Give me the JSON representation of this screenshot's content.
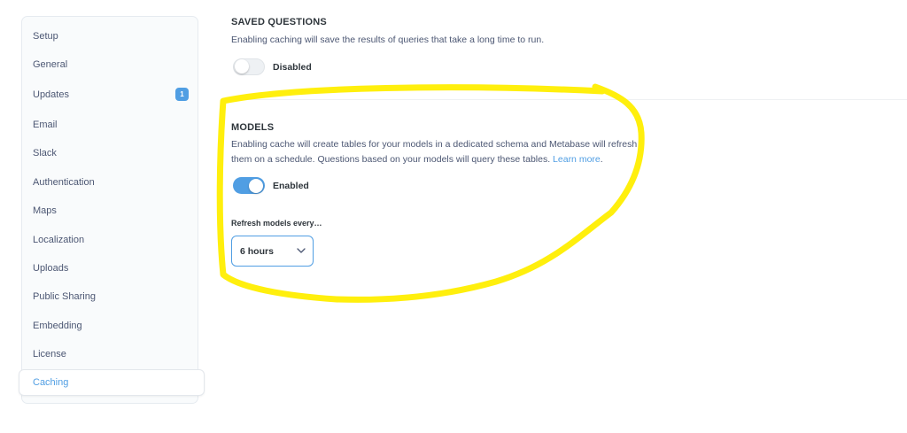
{
  "sidebar": {
    "items": [
      {
        "label": "Setup"
      },
      {
        "label": "General"
      },
      {
        "label": "Updates",
        "badge": "1"
      },
      {
        "label": "Email"
      },
      {
        "label": "Slack"
      },
      {
        "label": "Authentication"
      },
      {
        "label": "Maps"
      },
      {
        "label": "Localization"
      },
      {
        "label": "Uploads"
      },
      {
        "label": "Public Sharing"
      },
      {
        "label": "Embedding"
      },
      {
        "label": "License"
      },
      {
        "label": "Caching",
        "active": true
      }
    ]
  },
  "saved_questions": {
    "title": "SAVED QUESTIONS",
    "description": "Enabling caching will save the results of queries that take a long time to run.",
    "toggle_label": "Disabled",
    "enabled": false
  },
  "models": {
    "title": "MODELS",
    "description_line1": "Enabling cache will create tables for your models in a dedicated schema and Metabase will refresh",
    "description_line2": "them on a schedule. Questions based on your models will query these tables.",
    "learn_more": "Learn more",
    "description_end": ".",
    "toggle_label": "Enabled",
    "enabled": true,
    "refresh_label": "Refresh models every…",
    "refresh_value": "6 hours"
  },
  "colors": {
    "accent": "#509ee3",
    "highlight": "#ffee00"
  }
}
